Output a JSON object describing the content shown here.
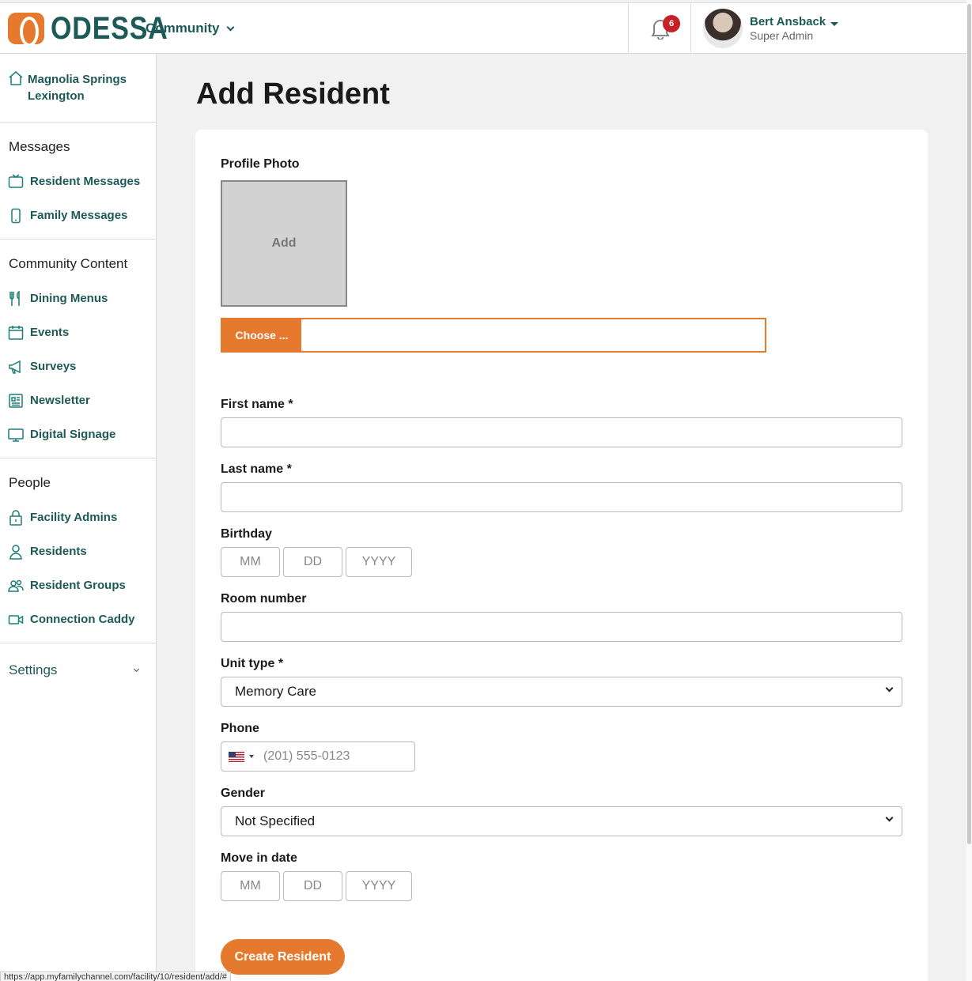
{
  "header": {
    "logo_text": "ODESSA",
    "community_label": "Community",
    "notification_count": "6",
    "user_name": "Bert Ansback",
    "user_role": "Super Admin"
  },
  "sidebar": {
    "facility_name": "Magnolia Springs Lexington",
    "messages_title": "Messages",
    "messages_items": [
      {
        "label": "Resident Messages",
        "icon": "tv-icon"
      },
      {
        "label": "Family Messages",
        "icon": "phone-icon"
      }
    ],
    "content_title": "Community Content",
    "content_items": [
      {
        "label": "Dining Menus",
        "icon": "utensils-icon"
      },
      {
        "label": "Events",
        "icon": "calendar-icon"
      },
      {
        "label": "Surveys",
        "icon": "megaphone-icon"
      },
      {
        "label": "Newsletter",
        "icon": "newspaper-icon"
      },
      {
        "label": "Digital Signage",
        "icon": "monitor-icon"
      }
    ],
    "people_title": "People",
    "people_items": [
      {
        "label": "Facility Admins",
        "icon": "lock-icon"
      },
      {
        "label": "Residents",
        "icon": "person-icon"
      },
      {
        "label": "Resident Groups",
        "icon": "group-icon"
      },
      {
        "label": "Connection Caddy",
        "icon": "video-icon"
      }
    ],
    "settings_label": "Settings"
  },
  "page": {
    "title": "Add Resident"
  },
  "form": {
    "profile_photo_label": "Profile Photo",
    "photo_add_label": "Add",
    "choose_label": "Choose ...",
    "first_name_label": "First name *",
    "last_name_label": "Last name *",
    "birthday_label": "Birthday",
    "mm_placeholder": "MM",
    "dd_placeholder": "DD",
    "yyyy_placeholder": "YYYY",
    "room_label": "Room number",
    "unit_type_label": "Unit type *",
    "unit_type_value": "Memory Care",
    "phone_label": "Phone",
    "phone_placeholder": "(201) 555-0123",
    "gender_label": "Gender",
    "gender_value": "Not Specified",
    "move_in_label": "Move in date",
    "submit_label": "Create Resident"
  },
  "status_bar": {
    "url": "https://app.myfamilychannel.com/facility/10/resident/add/#"
  },
  "colors": {
    "brand_orange": "#e57a2e",
    "brand_teal": "#1d5a57",
    "badge_red": "#c72127"
  }
}
